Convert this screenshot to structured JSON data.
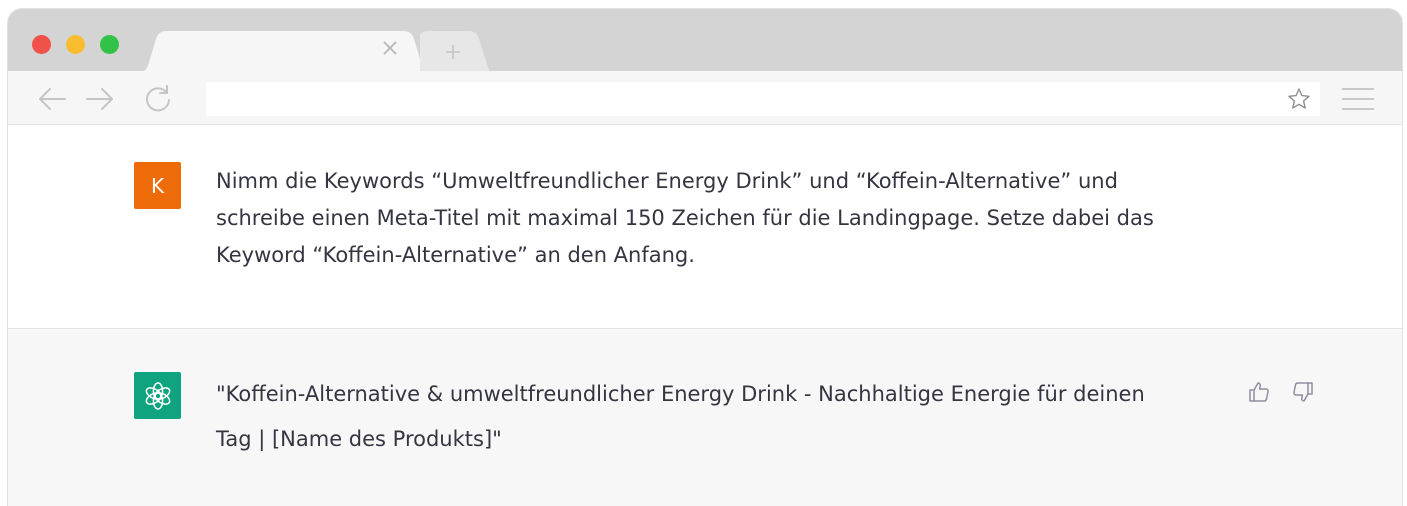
{
  "browser": {
    "address_value": "",
    "tab_close_glyph": "×",
    "new_tab_glyph": "+"
  },
  "icons": {
    "window_close": "red-dot",
    "window_minimize": "yellow-dot",
    "window_maximize": "green-dot",
    "back": "arrow-left-icon",
    "forward": "arrow-right-icon",
    "reload": "reload-icon",
    "bookmark": "star-icon",
    "menu": "hamburger-icon",
    "thumbs_up": "thumbs-up-icon",
    "thumbs_down": "thumbs-down-icon",
    "assistant_logo": "openai-logo-icon"
  },
  "colors": {
    "user_avatar": "#ee6b0a",
    "assistant_avatar": "#10a37f",
    "text": "#343541",
    "assistant_bg": "#f7f7f8"
  },
  "conversation": {
    "user": {
      "avatar_letter": "K",
      "text": "Nimm die Keywords “Umweltfreundlicher Energy Drink” und “Koffein-Alternative” und\nschreibe einen Meta-Titel mit maximal 150 Zeichen für die Landingpage. Setze dabei das\nKeyword “Koffein-Alternative” an den Anfang."
    },
    "assistant": {
      "text": "\"Koffein-Alternative & umweltfreundlicher Energy Drink - Nachhaltige Energie für deinen\nTag | [Name des Produkts]\""
    }
  }
}
